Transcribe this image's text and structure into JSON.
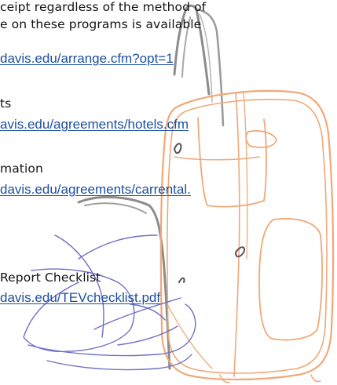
{
  "colors": {
    "link": "#1c4fa0",
    "text": "#111111",
    "suitcase_outline": "#f0a878",
    "handle_gray": "#8c8c8c",
    "strap_blue": "#6f6fc8"
  },
  "decoration": {
    "illustration": "suitcase-sketch",
    "icons": [
      "suitcase-icon",
      "handle-icon",
      "strap-scribble-icon"
    ]
  },
  "lines": {
    "intro_1": "ceipt regardless of the method of",
    "intro_2": "e on these programs is available",
    "link_arrange": "davis.edu/arrange.cfm?opt=1",
    "hotels_label": "ts",
    "link_hotels": "avis.edu/agreements/hotels.cfm",
    "carrental_label": "mation",
    "link_carrental": "davis.edu/agreements/carrental.",
    "checklist_label": "Report Checklist",
    "link_checklist": "davis.edu/TEVchecklist.pdf"
  }
}
